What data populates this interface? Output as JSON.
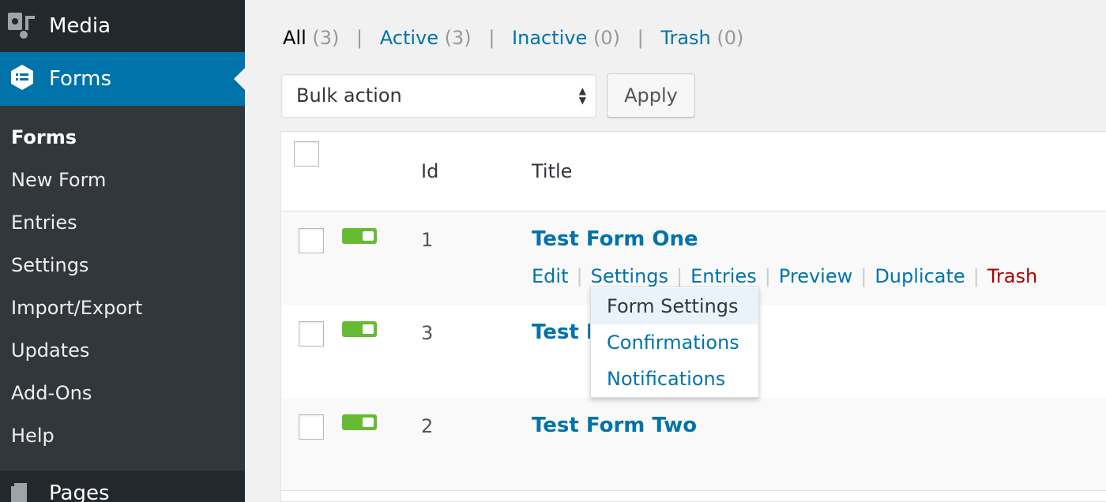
{
  "sidebar": {
    "media_label": "Media",
    "forms_label": "Forms",
    "submenu": [
      "Forms",
      "New Form",
      "Entries",
      "Settings",
      "Import/Export",
      "Updates",
      "Add-Ons",
      "Help"
    ],
    "pages_label": "Pages"
  },
  "filters": {
    "all": {
      "label": "All",
      "count": "(3)"
    },
    "active": {
      "label": "Active",
      "count": "(3)"
    },
    "inactive": {
      "label": "Inactive",
      "count": "(0)"
    },
    "trash": {
      "label": "Trash",
      "count": "(0)"
    },
    "separator": "|"
  },
  "bulk": {
    "selected": "Bulk action",
    "apply_label": "Apply"
  },
  "table": {
    "headers": {
      "id": "Id",
      "title": "Title"
    },
    "rows": [
      {
        "id": "1",
        "title": "Test Form One",
        "active": true
      },
      {
        "id": "3",
        "title": "Test F",
        "active": true
      },
      {
        "id": "2",
        "title": "Test Form Two",
        "active": true
      }
    ],
    "row_actions": {
      "edit": "Edit",
      "settings": "Settings",
      "entries": "Entries",
      "preview": "Preview",
      "duplicate": "Duplicate",
      "trash": "Trash",
      "separator": "|"
    }
  },
  "settings_dropdown": [
    "Form Settings",
    "Confirmations",
    "Notifications"
  ],
  "colors": {
    "accent": "#0073aa",
    "sidebar": "#23282d",
    "submenu": "#32373c",
    "active_toggle": "#66bb33",
    "trash": "#aa0000"
  }
}
